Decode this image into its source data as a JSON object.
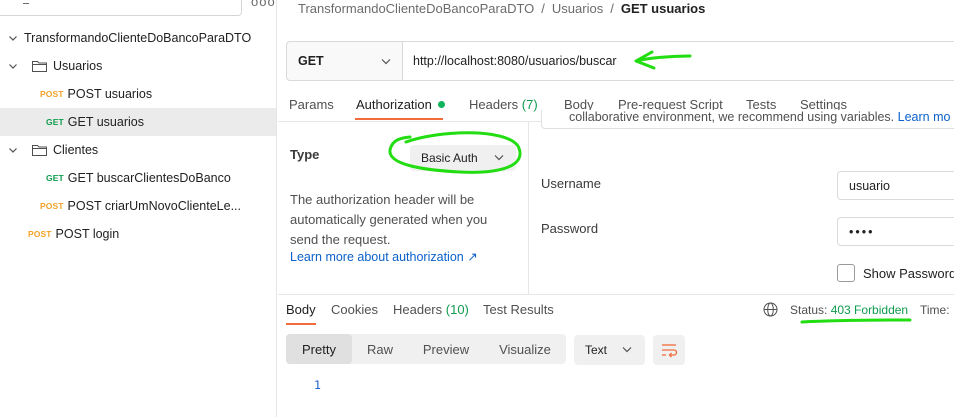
{
  "sidebar": {
    "more_label": "ooo",
    "items": [
      {
        "kind": "collection",
        "label": "TransformandoClienteDoBancoParaDTO"
      },
      {
        "kind": "folder",
        "label": "Usuarios"
      },
      {
        "kind": "request",
        "method": "POST",
        "label": "POST usuarios"
      },
      {
        "kind": "request",
        "method": "GET",
        "label": "GET usuarios",
        "selected": true
      },
      {
        "kind": "folder",
        "label": "Clientes"
      },
      {
        "kind": "request",
        "method": "GET",
        "label": "GET buscarClientesDoBanco"
      },
      {
        "kind": "request",
        "method": "POST",
        "label": "POST criarUmNovoClienteLe..."
      },
      {
        "kind": "request",
        "method": "POST",
        "label": "POST login"
      }
    ]
  },
  "breadcrumb": {
    "collection": "TransformandoClienteDoBancoParaDTO",
    "folder": "Usuarios",
    "current": "GET usuarios",
    "separator": "/"
  },
  "request": {
    "method": "GET",
    "url": "http://localhost:8080/usuarios/buscar"
  },
  "request_tabs": {
    "params": "Params",
    "authorization": "Authorization",
    "headers": "Headers",
    "headers_count": "(7)",
    "body": "Body",
    "prerequest": "Pre-request Script",
    "tests": "Tests",
    "settings": "Settings"
  },
  "auth": {
    "type_label": "Type",
    "type_value": "Basic Auth",
    "description": "The authorization header will be automatically generated when you send the request.",
    "learn_more": "Learn more about authorization ↗",
    "notice_text": "collaborative environment, we recommend using variables. ",
    "notice_link": "Learn mo",
    "username_label": "Username",
    "username_value": "usuario",
    "password_label": "Password",
    "password_value": "••••",
    "show_password": "Show Password"
  },
  "response": {
    "tabs": {
      "body": "Body",
      "cookies": "Cookies",
      "headers": "Headers",
      "headers_count": "(10)",
      "test_results": "Test Results"
    },
    "status_label": "Status:",
    "status_value": "403 Forbidden",
    "time_label": "Time:",
    "views": [
      "Pretty",
      "Raw",
      "Preview",
      "Visualize"
    ],
    "format": "Text",
    "line_number": "1"
  },
  "colors": {
    "accent": "#f26b3a",
    "get": "#0f9b4e",
    "post": "#f2a32a",
    "link": "#0b61c9",
    "annotation": "#22dd11"
  },
  "icons": [
    "filter-icon",
    "more-icon",
    "chevron-down-icon",
    "chevron-right-icon",
    "folder-icon",
    "globe-icon",
    "wrap-icon",
    "external-link-icon"
  ]
}
